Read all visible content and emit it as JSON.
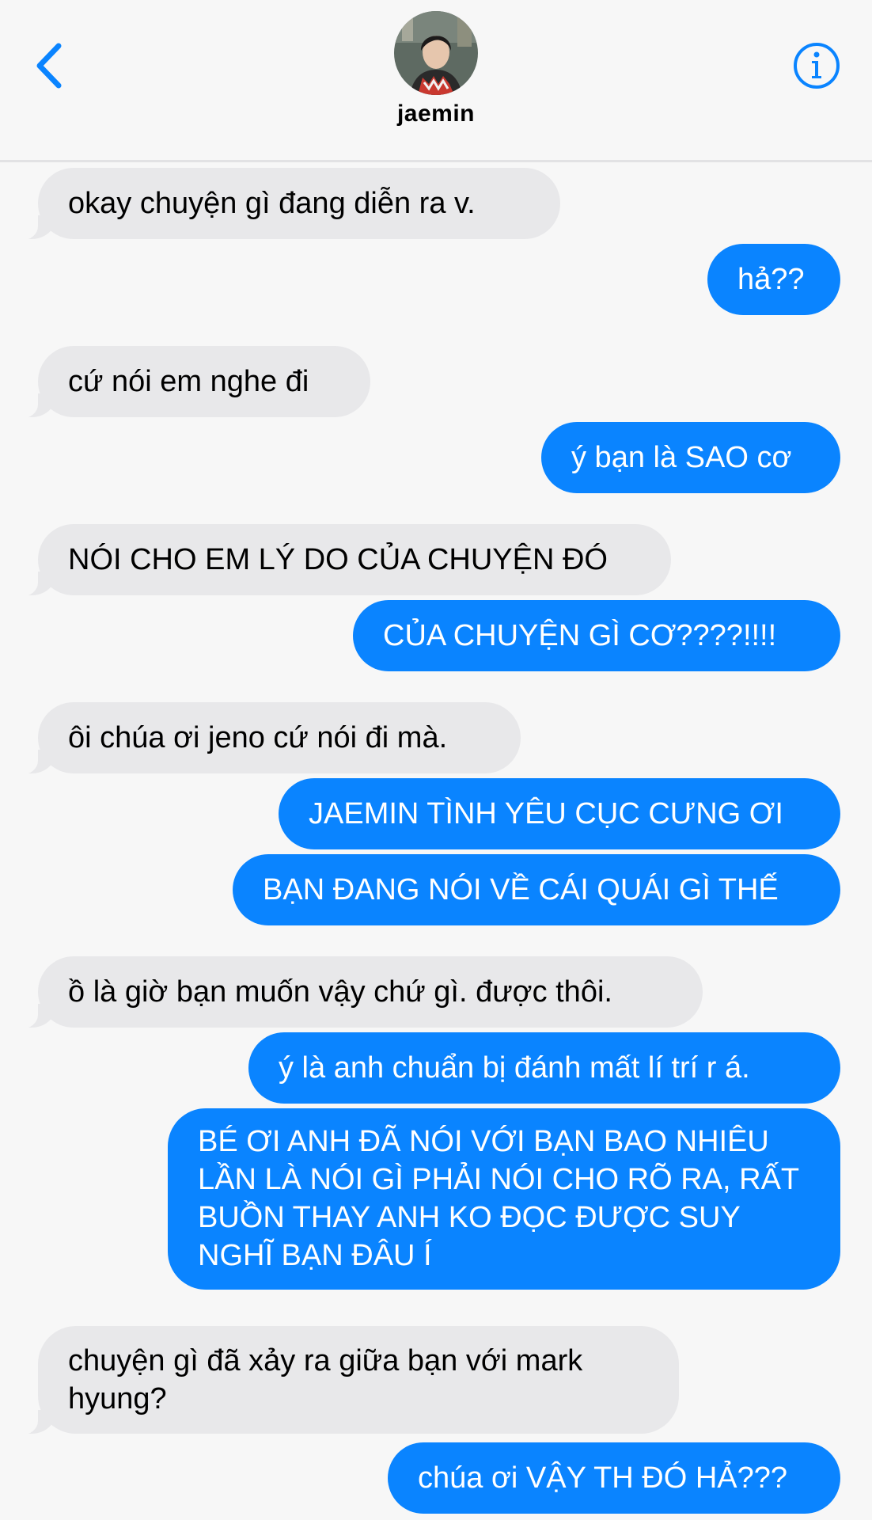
{
  "header": {
    "contact_name": "jaemin",
    "back_icon": "chevron-left-icon",
    "info_icon": "info-icon",
    "accent": "#0a84ff"
  },
  "messages": [
    {
      "side": "received",
      "text": "okay chuyện gì đang diễn ra v."
    },
    {
      "side": "sent",
      "text": "hả??"
    },
    {
      "side": "received",
      "text": "cứ nói em nghe đi"
    },
    {
      "side": "sent",
      "text": "ý bạn là SAO cơ"
    },
    {
      "side": "received",
      "text": "NÓI CHO EM LÝ DO CỦA CHUYỆN ĐÓ"
    },
    {
      "side": "sent",
      "text": "CỦA CHUYỆN GÌ CƠ????!!!!"
    },
    {
      "side": "received",
      "text": "ôi chúa ơi jeno cứ nói đi mà."
    },
    {
      "side": "sent",
      "text": "JAEMIN TÌNH YÊU CỤC CƯNG ƠI"
    },
    {
      "side": "sent",
      "text": "BẠN ĐANG NÓI VỀ CÁI QUÁI GÌ THẾ"
    },
    {
      "side": "received",
      "text": "ồ là giờ bạn muốn vậy chứ gì. được thôi."
    },
    {
      "side": "sent",
      "text": "ý là anh chuẩn bị đánh mất lí trí r á."
    },
    {
      "side": "sent",
      "text": "BÉ ƠI ANH ĐÃ NÓI VỚI BẠN BAO NHIÊU LẦN LÀ NÓI GÌ PHẢI NÓI CHO RÕ RA, RẤT BUỒN THAY ANH KO ĐỌC ĐƯỢC SUY NGHĨ BẠN ĐÂU Í"
    },
    {
      "side": "received",
      "text": "chuyện gì đã xảy ra giữa bạn với mark hyung?"
    },
    {
      "side": "sent",
      "text": "chúa ơi VẬY TH ĐÓ HẢ???"
    }
  ]
}
